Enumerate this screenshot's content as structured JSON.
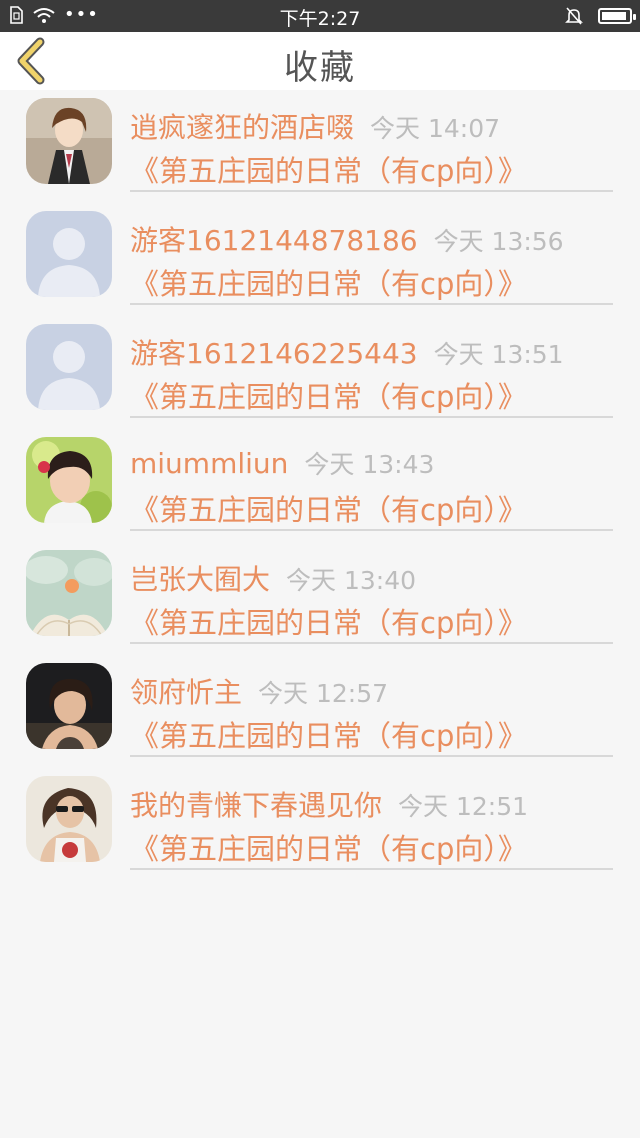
{
  "status_bar": {
    "time": "下午2:27"
  },
  "header": {
    "title": "收藏"
  },
  "favorites": [
    {
      "user": "逍疯邃狂的酒店啜",
      "time": "今天 14:07",
      "title": "《第五庄园的日常（有cp向）》",
      "avatar": "anime-boy-avatar"
    },
    {
      "user": "游客1612144878186",
      "time": "今天 13:56",
      "title": "《第五庄园的日常（有cp向）》",
      "avatar": "default-avatar"
    },
    {
      "user": "游客1612146225443",
      "time": "今天 13:51",
      "title": "《第五庄园的日常（有cp向）》",
      "avatar": "default-avatar"
    },
    {
      "user": "miummliun",
      "time": "今天 13:43",
      "title": "《第五庄园的日常（有cp向）》",
      "avatar": "girl-avatar"
    },
    {
      "user": "岂张大囿大",
      "time": "今天 13:40",
      "title": "《第五庄园的日常（有cp向）》",
      "avatar": "book-heart-avatar"
    },
    {
      "user": "领府忻主",
      "time": "今天 12:57",
      "title": "《第五庄园的日常（有cp向）》",
      "avatar": "woman-portrait-avatar"
    },
    {
      "user": "我的青慊下春遇见你",
      "time": "今天 12:51",
      "title": "《第五庄园的日常（有cp向）》",
      "avatar": "sunglasses-girl-avatar"
    }
  ],
  "colors": {
    "accent": "#e98e5f",
    "timestamp": "#bdbdbd",
    "back_icon": "#f0d36a"
  }
}
